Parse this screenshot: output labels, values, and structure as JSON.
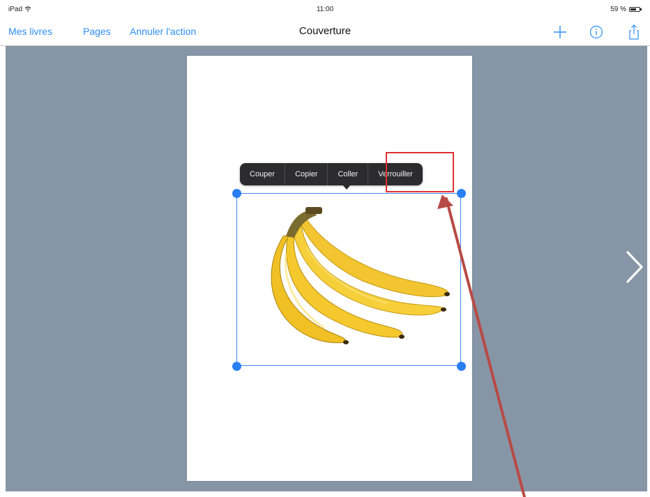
{
  "status_bar": {
    "device": "iPad",
    "time": "11:00",
    "battery": "59 %"
  },
  "nav": {
    "my_books": "Mes livres",
    "pages": "Pages",
    "undo": "Annuler l'action",
    "title": "Couverture"
  },
  "context_menu": {
    "items": [
      "Couper",
      "Copier",
      "Coller",
      "Verrouiller"
    ]
  },
  "colors": {
    "accent": "#2f8df5",
    "selection": "#3e86f0",
    "canvas": "#8796a6",
    "menu_bg": "#2c2c2e",
    "annotation": "#e03030",
    "arrow": "#b84a45"
  },
  "icons": {
    "add": "plus-icon",
    "info": "info-icon",
    "share": "share-icon",
    "next": "chevron-right-icon",
    "wifi": "wifi-icon",
    "battery": "battery-icon"
  }
}
